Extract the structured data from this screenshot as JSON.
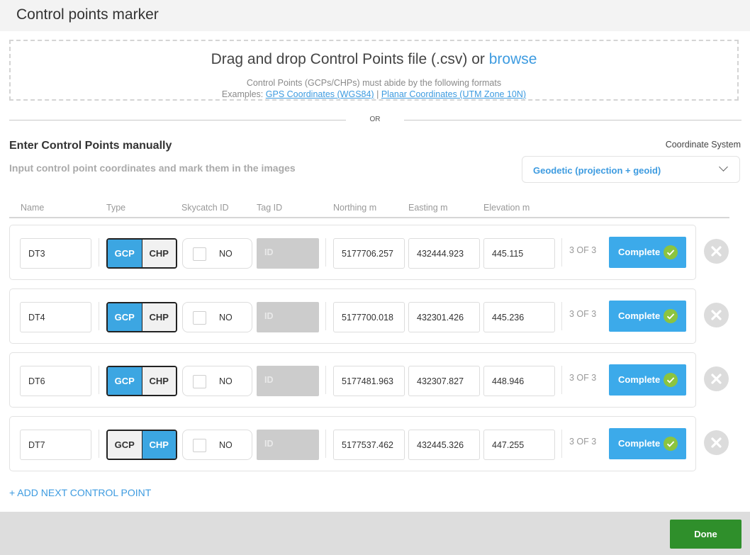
{
  "header": {
    "title": "Control points marker"
  },
  "dropzone": {
    "main_text": "Drag and drop Control Points file (.csv) or",
    "browse_label": "browse",
    "formats_text": "Control Points (GCPs/CHPs) must abide by the following formats",
    "examples_prefix": "Examples:",
    "example_1": "GPS Coordinates (WGS84)",
    "separator": "|",
    "example_2": "Planar Coordinates (UTM Zone 10N)"
  },
  "divider": {
    "or_text": "OR"
  },
  "manual": {
    "title": "Enter Control Points manually",
    "subtitle": "Input control point coordinates and mark them in the images",
    "coord_label": "Coordinate System",
    "coord_value": "Geodetic (projection + geoid)"
  },
  "columns": [
    "Name",
    "Type",
    "Skycatch ID",
    "Tag ID",
    "Northing m",
    "Easting m",
    "Elevation m"
  ],
  "type_options": {
    "gcp": "GCP",
    "chp": "CHP"
  },
  "skycatch_no": "NO",
  "tag_placeholder": "ID",
  "complete_label": "Complete",
  "rows": [
    {
      "name": "DT3",
      "type": "GCP",
      "northing": "5177706.257",
      "easting": "432444.923",
      "elevation": "445.115",
      "count": "3 OF 3"
    },
    {
      "name": "DT4",
      "type": "GCP",
      "northing": "5177700.018",
      "easting": "432301.426",
      "elevation": "445.236",
      "count": "3 OF 3"
    },
    {
      "name": "DT6",
      "type": "GCP",
      "northing": "5177481.963",
      "easting": "432307.827",
      "elevation": "448.946",
      "count": "3 OF 3"
    },
    {
      "name": "DT7",
      "type": "CHP",
      "northing": "5177537.462",
      "easting": "432445.326",
      "elevation": "447.255",
      "count": "3 OF 3"
    }
  ],
  "add_link": "+ ADD NEXT CONTROL POINT",
  "footer": {
    "done_label": "Done"
  },
  "colors": {
    "accent": "#3ca6e2",
    "complete_check": "#8cc43f",
    "done": "#2f8f2b"
  },
  "icons": {
    "remove": "close-circle-icon",
    "complete": "check-circle-icon",
    "dropdown": "chevron-down-icon"
  }
}
